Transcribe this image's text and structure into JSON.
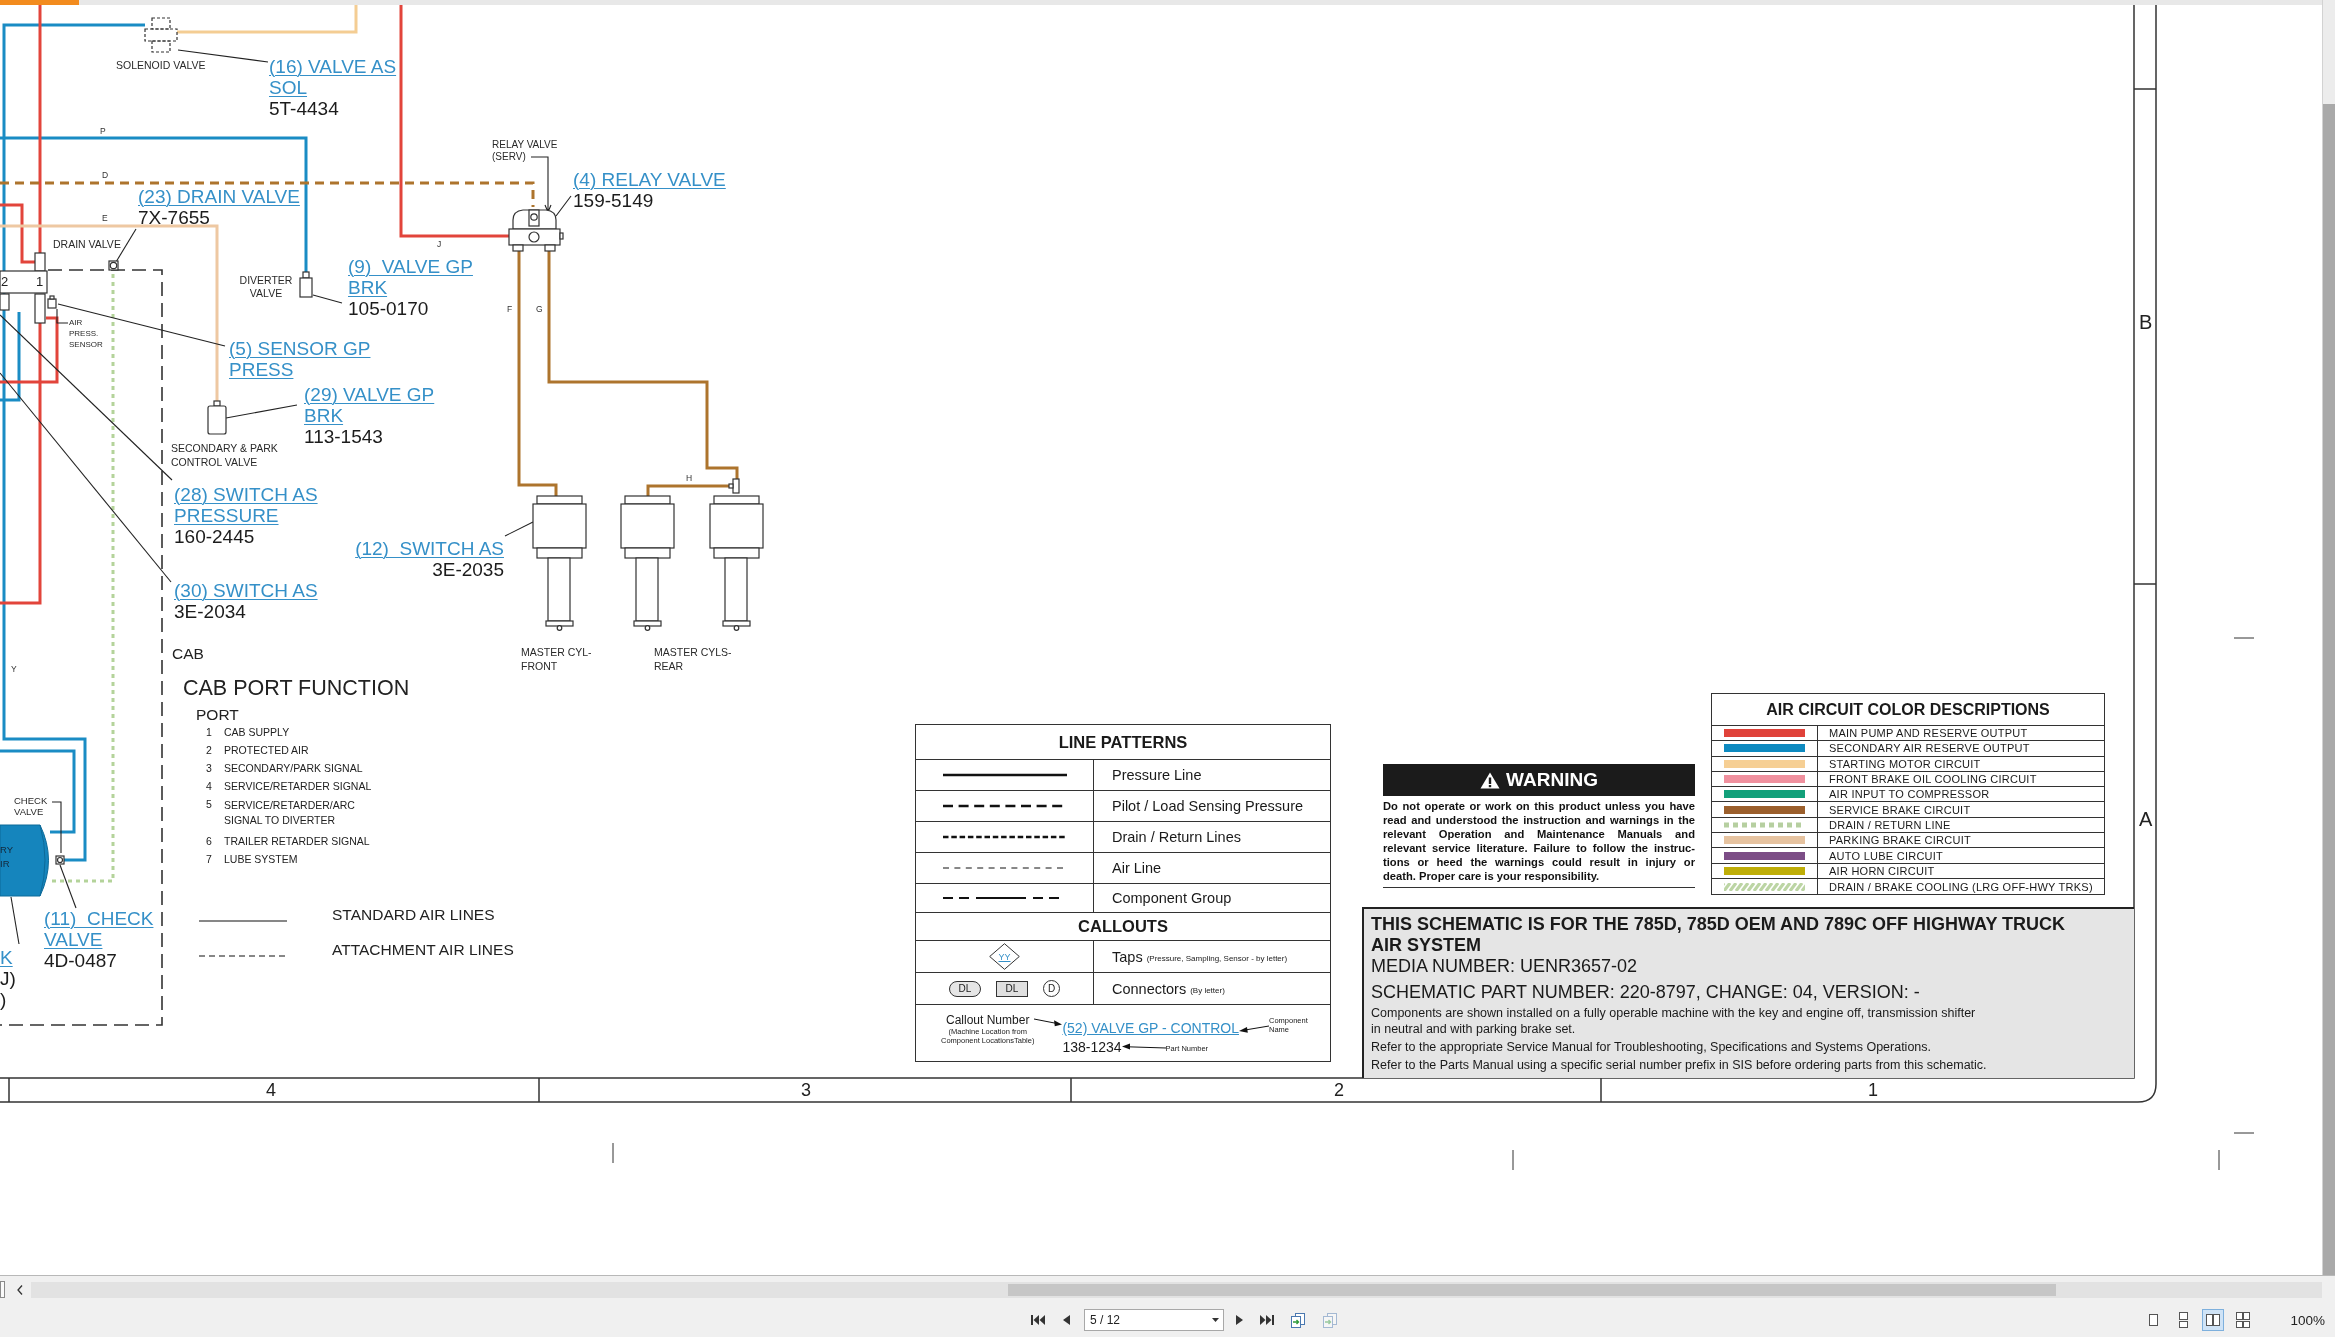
{
  "schematic": {
    "callouts": [
      {
        "name_lines": [
          "(16) VALVE AS",
          "SOL"
        ],
        "part_lines": [
          "5T-4434"
        ]
      },
      {
        "name_lines": [
          "(4) RELAY VALVE"
        ],
        "part_lines": [
          "159-5149"
        ]
      },
      {
        "name_lines": [
          "(23) DRAIN VALVE"
        ],
        "part_lines": [
          "7X-7655"
        ]
      },
      {
        "name_lines": [
          "(9)  VALVE GP",
          "BRK"
        ],
        "part_lines": [
          "105-0170"
        ]
      },
      {
        "name_lines": [
          "(5) SENSOR GP",
          "PRESS"
        ]
      },
      {
        "name_lines": [
          "(29) VALVE GP",
          "BRK"
        ],
        "part_lines": [
          "113-1543"
        ]
      },
      {
        "name_lines": [
          "(28) SWITCH AS",
          "PRESSURE"
        ],
        "part_lines": [
          "160-2445"
        ]
      },
      {
        "name_lines": [
          "(12)  SWITCH AS"
        ],
        "part_lines": [
          "3E-2035"
        ]
      },
      {
        "name_lines": [
          "(30) SWITCH AS"
        ],
        "part_lines": [
          "3E-2034"
        ]
      },
      {
        "name_lines": [
          "(11)  CHECK",
          "VALVE"
        ],
        "part_lines": [
          "4D-0487"
        ]
      },
      {
        "name_lines": [
          "K"
        ],
        "detail_lines": [
          "J)",
          ")"
        ]
      }
    ],
    "component_labels": [
      {
        "lines": [
          "SOLENOID VALVE"
        ]
      },
      {
        "lines": [
          "RELAY VALVE",
          "(SERV)"
        ]
      },
      {
        "lines": [
          "DRAIN VALVE"
        ]
      },
      {
        "lines": [
          "DIVERTER",
          "VALVE"
        ]
      },
      {
        "lines": [
          "AIR",
          "PRESS.",
          "SENSOR"
        ]
      },
      {
        "lines": [
          "SECONDARY & PARK",
          "CONTROL VALVE"
        ]
      },
      {
        "lines": [
          "MASTER CYL-",
          "FRONT"
        ]
      },
      {
        "lines": [
          "MASTER CYLS-",
          "REAR"
        ]
      },
      {
        "lines": [
          "CHECK",
          "VALVE"
        ]
      },
      {
        "lines": [
          "RY",
          "IR"
        ]
      }
    ],
    "line_letters": [
      "P",
      "D",
      "E",
      "J",
      "F",
      "G",
      "H",
      "Y"
    ],
    "manifold_ports": [
      "2",
      "1"
    ],
    "cab_ports": {
      "area_label": "CAB",
      "title": "CAB PORT FUNCTION",
      "heading": "PORT",
      "ports": [
        {
          "number": "1",
          "lines": [
            "CAB SUPPLY"
          ]
        },
        {
          "number": "2",
          "lines": [
            "PROTECTED AIR"
          ]
        },
        {
          "number": "3",
          "lines": [
            "SECONDARY/PARK SIGNAL"
          ]
        },
        {
          "number": "4",
          "lines": [
            "SERVICE/RETARDER SIGNAL"
          ]
        },
        {
          "number": "5",
          "lines": [
            "SERVICE/RETARDER/ARC",
            "SIGNAL TO DIVERTER"
          ]
        },
        {
          "number": "6",
          "lines": [
            "TRAILER RETARDER SIGNAL"
          ]
        },
        {
          "number": "7",
          "lines": [
            "LUBE SYSTEM"
          ]
        }
      ]
    },
    "air_line_types": [
      {
        "kind": "solid",
        "label": "STANDARD AIR LINES"
      },
      {
        "kind": "dashed",
        "label": "ATTACHMENT AIR LINES"
      }
    ],
    "line_patterns": {
      "title": "LINE PATTERNS",
      "rows": [
        {
          "kind": "solid",
          "label": "Pressure Line"
        },
        {
          "kind": "dashed",
          "label": "Pilot / Load Sensing Pressure"
        },
        {
          "kind": "dotted",
          "label": "Drain / Return Lines"
        },
        {
          "kind": "thin-dashed",
          "label": "Air Line"
        },
        {
          "kind": "dash-dot",
          "label": "Component Group"
        }
      ],
      "callouts_title": "CALLOUTS",
      "taps": {
        "symbol": "YY",
        "label": "Taps",
        "note": "(Pressure, Sampling, Sensor - by letter)"
      },
      "connectors": {
        "symbols": [
          {
            "kind": "rounded",
            "text": "DL"
          },
          {
            "kind": "square",
            "text": "DL"
          },
          {
            "kind": "circle",
            "text": "D"
          }
        ],
        "label": "Connectors",
        "note": "(By letter)"
      },
      "example": {
        "callout_label": "Callout Number",
        "callout_note_lines": [
          "(Machine Location from",
          "Component LocationsTable)"
        ],
        "link": "(52) VALVE GP - CONTROL",
        "name_label_lines": [
          "Component",
          "Name"
        ],
        "part_number": "138-1234",
        "part_label": "Part Number"
      }
    },
    "warning": {
      "title": "WARNING",
      "lines": [
        "Do not operate or work on this product unless you have",
        "read and understood the instruction and warnings in the",
        "relevant Operation and Maintenance Manuals and",
        "relevant service literature. Failure to follow the instruc-",
        "tions or heed the warnings could result in injury or",
        "death. Proper care is your responsibility."
      ]
    },
    "air_circuit_colors": {
      "title": "AIR CIRCUIT COLOR DESCRIPTIONS",
      "rows": [
        {
          "kind": "solid",
          "color": "#e0423a",
          "label": "MAIN PUMP AND RESERVE OUTPUT"
        },
        {
          "kind": "solid",
          "color": "#0e8ac0",
          "label": "SECONDARY AIR RESERVE OUTPUT"
        },
        {
          "kind": "solid",
          "color": "#f6cf94",
          "label": "STARTING MOTOR CIRCUIT"
        },
        {
          "kind": "solid",
          "color": "#f0909e",
          "label": "FRONT BRAKE OIL COOLING CIRCUIT"
        },
        {
          "kind": "solid",
          "color": "#12a07a",
          "label": "AIR INPUT TO COMPRESSOR"
        },
        {
          "kind": "solid",
          "color": "#9b5f2c",
          "label": "SERVICE BRAKE CIRCUIT"
        },
        {
          "kind": "dotted",
          "color": "#b6cfa0",
          "label": "DRAIN / RETURN LINE"
        },
        {
          "kind": "solid",
          "color": "#e6c3a0",
          "label": "PARKING BRAKE CIRCUIT"
        },
        {
          "kind": "solid",
          "color": "#7c4d86",
          "label": "AUTO LUBE CIRCUIT"
        },
        {
          "kind": "solid",
          "color": "#bfae07",
          "label": "AIR HORN CIRCUIT"
        },
        {
          "kind": "hatched",
          "color": "#bcd5a4",
          "label": "DRAIN / BRAKE COOLING (LRG OFF-HWY TRKS)"
        }
      ]
    },
    "info": {
      "title_lines": [
        "THIS SCHEMATIC IS FOR THE 785D, 785D OEM AND 789C OFF HIGHWAY TRUCK",
        "AIR SYSTEM"
      ],
      "media_number": "MEDIA NUMBER: UENR3657-02",
      "part_number": "SCHEMATIC PART NUMBER: 220-8797, CHANGE: 04, VERSION: -",
      "notes": [
        {
          "lines": [
            "Components are shown installed on a fully operable machine with the key and engine off, transmission shifter",
            "in neutral and with parking brake set."
          ]
        },
        {
          "lines": [
            "Refer to the appropriate Service Manual for Troubleshooting, Specifications and Systems Operations."
          ]
        },
        {
          "lines": [
            "Refer to the Parts Manual using a specific serial number prefix in SIS before ordering parts from this schematic."
          ]
        }
      ]
    },
    "zones": {
      "columns": [
        "4",
        "3",
        "2",
        "1"
      ],
      "rows": [
        "B",
        "A"
      ]
    }
  },
  "bottom_toolbar": {
    "page_field": {
      "value": "5 / 12"
    },
    "page_tools": [
      {
        "disabled": false
      },
      {
        "disabled": true
      }
    ],
    "view_modes": [
      {
        "kind": "single-page",
        "selected": false
      },
      {
        "kind": "continuous",
        "selected": false
      },
      {
        "kind": "two-page",
        "selected": true
      },
      {
        "kind": "two-page-continuous",
        "selected": false
      }
    ],
    "zoom": "100%"
  }
}
